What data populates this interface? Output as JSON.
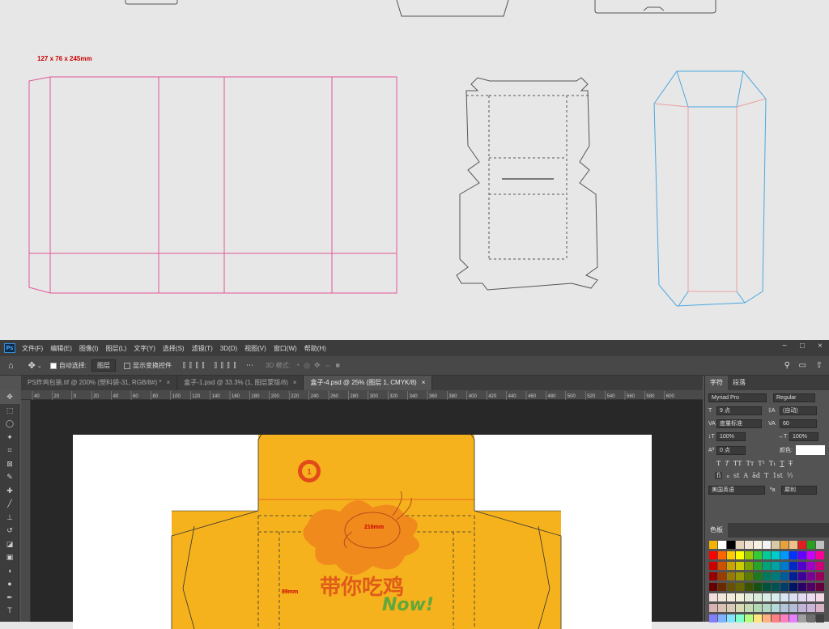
{
  "top_section": {
    "dimension_label": "127 x 76 x 245mm"
  },
  "menubar": {
    "logo": "Ps",
    "items": [
      "文件(F)",
      "编辑(E)",
      "图像(I)",
      "图层(L)",
      "文字(Y)",
      "选择(S)",
      "滤镜(T)",
      "3D(D)",
      "视图(V)",
      "窗口(W)",
      "帮助(H)"
    ],
    "window_controls": [
      "−",
      "□",
      "×"
    ]
  },
  "options_bar": {
    "auto_select_label": "自动选择:",
    "auto_select_value": "图层",
    "show_transform_label": "显示变换控件",
    "mode_3d_label": "3D 模式:"
  },
  "tabs": [
    {
      "label": "PS炸鸡包装.tif @ 200% (塑料袋-31, RGB/8#) *",
      "close": "×"
    },
    {
      "label": "盒子-1.psd @ 33.3% (1, 图层蒙版/8)",
      "close": "×"
    },
    {
      "label": "盒子-4.psd @ 25% (图层 1, CMYK/8)",
      "close": "×"
    }
  ],
  "ruler": {
    "ticks": [
      "40",
      "20",
      "0",
      "20",
      "40",
      "60",
      "80",
      "100",
      "120",
      "140",
      "160",
      "180",
      "200",
      "220",
      "240",
      "260",
      "280",
      "300",
      "320",
      "340",
      "360",
      "380",
      "400",
      "420",
      "440",
      "460",
      "480",
      "500",
      "520",
      "540",
      "560",
      "580",
      "600"
    ]
  },
  "artwork": {
    "dim_top": "216mm",
    "dim_side": "89mm",
    "slogan": "带你吃鸡",
    "now": "Now!"
  },
  "character_panel": {
    "tabs": [
      "字符",
      "段落"
    ],
    "font_family": "Myriad Pro",
    "font_style": "Regular",
    "font_size": "9 点",
    "leading": "(自动)",
    "kerning": "度量标准",
    "tracking": "60",
    "vscale": "100%",
    "hscale": "100%",
    "baseline": "0 点",
    "color_label": "颜色:",
    "style_buttons": [
      "T",
      "T",
      "TT",
      "Tт",
      "T¹",
      "T₁",
      "T",
      "T̶"
    ],
    "ot_buttons": [
      "fi",
      "ℴ",
      "st",
      "A",
      "ād",
      "T",
      "1st",
      "½"
    ],
    "language": "美国英语",
    "aa_label": "ªa",
    "antialias": "犀利"
  },
  "swatches_panel": {
    "title": "色板",
    "colors": [
      "#f5b200",
      "#ffffff",
      "#000000",
      "#e5d3bd",
      "#f2e5d3",
      "#f9f0e2",
      "#f3f3f3",
      "#d8c9a5",
      "#e6a23c",
      "#f0c08a",
      "#e02020",
      "#2aa020",
      "#c0c0c0",
      "#ff0000",
      "#ff6600",
      "#ffcc00",
      "#ffff00",
      "#99cc00",
      "#33cc33",
      "#00cc99",
      "#00cccc",
      "#0099ff",
      "#0033ff",
      "#6600ff",
      "#cc00ff",
      "#ff0099",
      "#cc0000",
      "#cc5200",
      "#cca300",
      "#cccc00",
      "#7aa300",
      "#29a329",
      "#00a37a",
      "#00a3a3",
      "#007acc",
      "#0029cc",
      "#5200cc",
      "#a300cc",
      "#cc007a",
      "#990000",
      "#993d00",
      "#997a00",
      "#999900",
      "#5c7a00",
      "#1f7a1f",
      "#007a5c",
      "#007a7a",
      "#005c99",
      "#001f99",
      "#3d0099",
      "#7a0099",
      "#99005c",
      "#660000",
      "#662900",
      "#665200",
      "#666600",
      "#3d5200",
      "#145214",
      "#00523d",
      "#005252",
      "#003d66",
      "#001466",
      "#290066",
      "#520066",
      "#66003d",
      "#f2dede",
      "#f2e5d9",
      "#f2ecd9",
      "#f2f2d9",
      "#e5ecd9",
      "#d9ecd9",
      "#d9ece5",
      "#d9ecec",
      "#d9e5f2",
      "#d9def2",
      "#e5d9f2",
      "#ecd9f2",
      "#f2d9e5",
      "#d9b3b3",
      "#d9c2b3",
      "#d9ccb3",
      "#d9d9b3",
      "#c6d9b3",
      "#b3d9b3",
      "#b3d9c6",
      "#b3d9d9",
      "#b3c6d9",
      "#b3bcd9",
      "#c2b3d9",
      "#ccb3d9",
      "#d9b3c6",
      "#8080ff",
      "#80b3ff",
      "#80e6ff",
      "#80ffcc",
      "#b3ff80",
      "#ffe680",
      "#ffb380",
      "#ff8080",
      "#ff80bf",
      "#e680ff",
      "#a0a0a0",
      "#707070",
      "#404040"
    ]
  }
}
